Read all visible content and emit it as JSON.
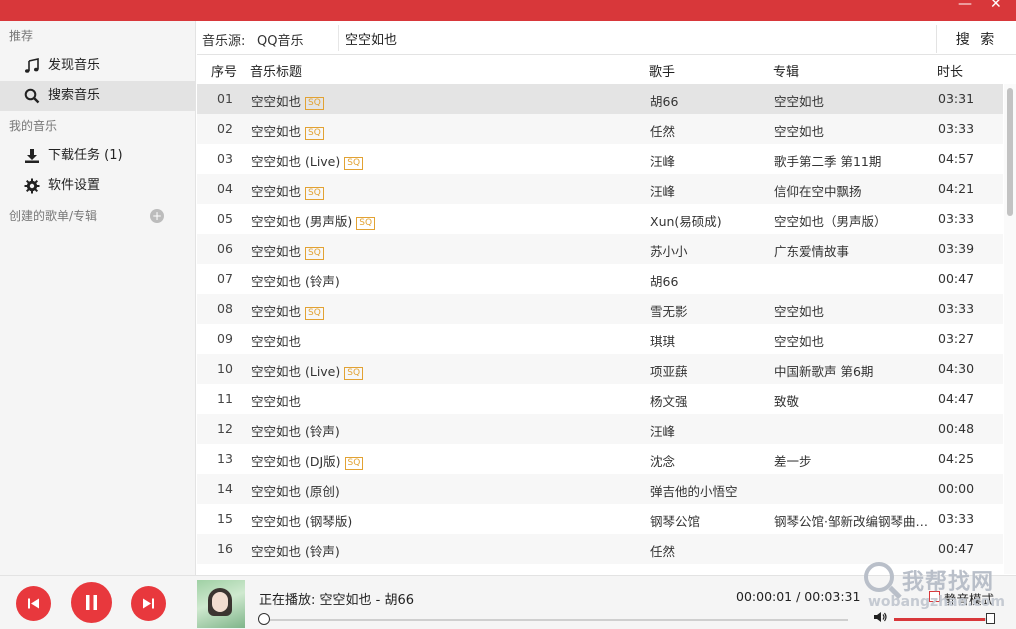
{
  "app": {
    "title": ""
  },
  "colors": {
    "accent": "#d8373a",
    "sq_badge": "#e2a233"
  },
  "sidebar": {
    "section_recommend": "推荐",
    "discover": "发现音乐",
    "search": "搜索音乐",
    "section_mine": "我的音乐",
    "downloads": "下载任务 (1)",
    "settings": "软件设置",
    "section_playlists": "创建的歌单/专辑"
  },
  "search": {
    "source_label": "音乐源:",
    "source_value": "QQ音乐",
    "query": "空空如也",
    "button": "搜 索"
  },
  "table": {
    "headers": {
      "no": "序号",
      "title": "音乐标题",
      "artist": "歌手",
      "album": "专辑",
      "duration": "时长"
    },
    "sq_label": "SQ",
    "rows": [
      {
        "no": "01",
        "title": "空空如也",
        "sq": "SQ",
        "artist": "胡66",
        "album": "空空如也",
        "duration": "03:31"
      },
      {
        "no": "02",
        "title": "空空如也",
        "sq": "SQ",
        "artist": "任然",
        "album": "空空如也",
        "duration": "03:33"
      },
      {
        "no": "03",
        "title": "空空如也 (Live)",
        "sq": "SQ",
        "artist": "汪峰",
        "album": "歌手第二季 第11期",
        "duration": "04:57"
      },
      {
        "no": "04",
        "title": "空空如也",
        "sq": "SQ",
        "artist": "汪峰",
        "album": "信仰在空中飘扬",
        "duration": "04:21"
      },
      {
        "no": "05",
        "title": "空空如也 (男声版)",
        "sq": "SQ",
        "artist": "Xun(易硕成)",
        "album": "空空如也（男声版）",
        "duration": "03:33"
      },
      {
        "no": "06",
        "title": "空空如也",
        "sq": "SQ",
        "artist": "苏小小",
        "album": "广东爱情故事",
        "duration": "03:39"
      },
      {
        "no": "07",
        "title": "空空如也 (铃声)",
        "sq": "",
        "artist": "胡66",
        "album": "",
        "duration": "00:47"
      },
      {
        "no": "08",
        "title": "空空如也",
        "sq": "SQ",
        "artist": "雪无影",
        "album": "空空如也",
        "duration": "03:33"
      },
      {
        "no": "09",
        "title": "空空如也",
        "sq": "",
        "artist": "琪琪",
        "album": "空空如也",
        "duration": "03:27"
      },
      {
        "no": "10",
        "title": "空空如也 (Live)",
        "sq": "SQ",
        "artist": "项亚蕻",
        "album": "中国新歌声 第6期",
        "duration": "04:30"
      },
      {
        "no": "11",
        "title": "空空如也",
        "sq": "",
        "artist": "杨文强",
        "album": "致敬",
        "duration": "04:47"
      },
      {
        "no": "12",
        "title": "空空如也 (铃声)",
        "sq": "",
        "artist": "汪峰",
        "album": "",
        "duration": "00:48"
      },
      {
        "no": "13",
        "title": "空空如也 (DJ版)",
        "sq": "SQ",
        "artist": "沈念",
        "album": "差一步",
        "duration": "04:25"
      },
      {
        "no": "14",
        "title": "空空如也 (原创)",
        "sq": "",
        "artist": "弹吉他的小悟空",
        "album": "",
        "duration": "00:00"
      },
      {
        "no": "15",
        "title": "空空如也 (钢琴版)",
        "sq": "",
        "artist": "钢琴公馆",
        "album": "钢琴公馆·邹新改编钢琴曲精…",
        "duration": "03:33"
      },
      {
        "no": "16",
        "title": "空空如也 (铃声)",
        "sq": "",
        "artist": "任然",
        "album": "",
        "duration": "00:47"
      }
    ]
  },
  "player": {
    "now_playing": "正在播放: 空空如也 - 胡66",
    "time": "00:00:01 / 00:03:31",
    "progress": 0.005,
    "volume": 0.95,
    "mute_label": "静音模式",
    "mute_checked": false
  },
  "watermark": {
    "cn": "我帮找网",
    "url": "wobangzhao.com"
  }
}
